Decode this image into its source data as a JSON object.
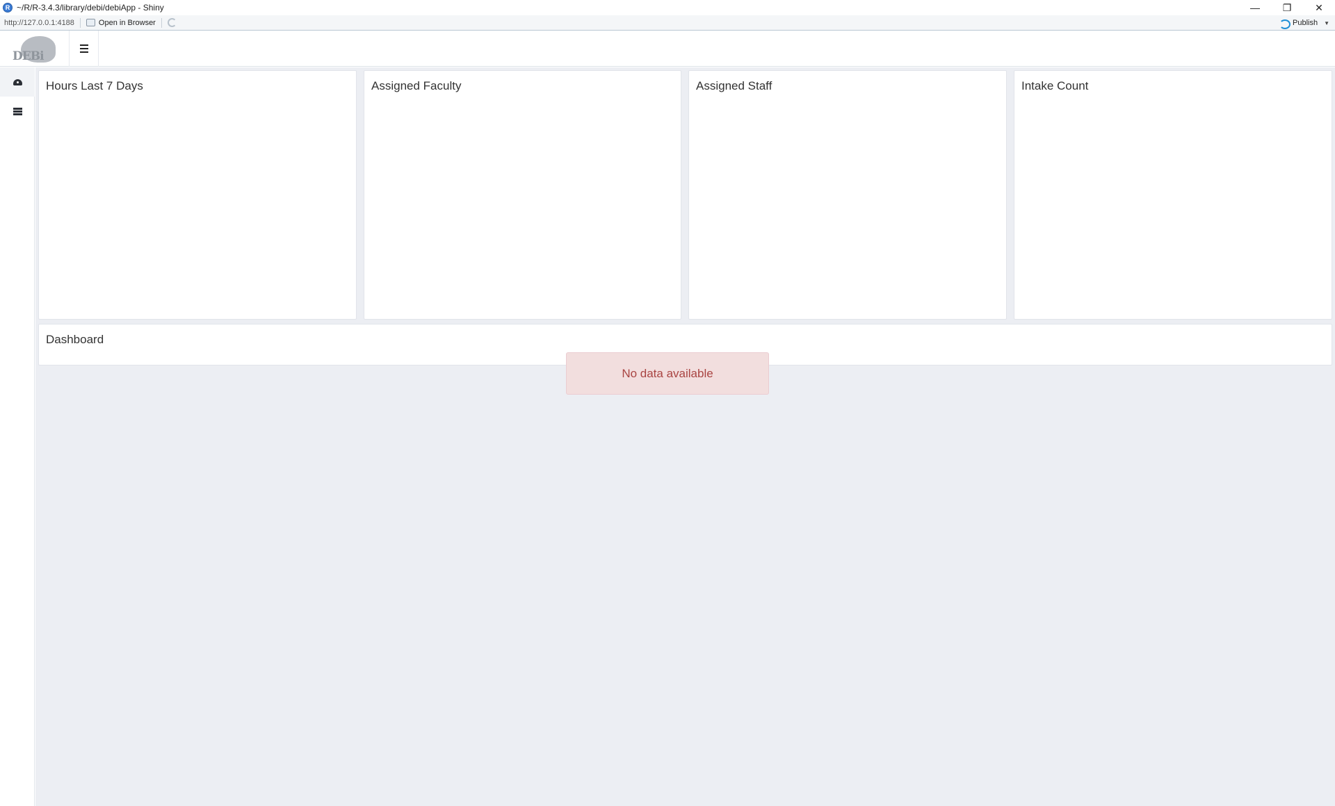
{
  "window": {
    "title": "~/R/R-3.4.3/library/debi/debiApp - Shiny",
    "app_icon": "R-studio-icon",
    "controls": [
      "minimize",
      "restore",
      "close"
    ]
  },
  "toolbar": {
    "url": "http://127.0.0.1:4188",
    "open_in_browser_label": "Open in Browser",
    "publish_label": "Publish"
  },
  "header": {
    "logo_text": "DEBi",
    "menu_icon": "hamburger-icon"
  },
  "sidebar": {
    "items": [
      {
        "icon": "dashboard-icon",
        "active": true
      },
      {
        "icon": "table-icon",
        "active": false
      }
    ]
  },
  "main": {
    "boxes": [
      {
        "title": "Hours Last 7 Days"
      },
      {
        "title": "Assigned Faculty"
      },
      {
        "title": "Assigned Staff"
      },
      {
        "title": "Intake Count"
      }
    ],
    "dashboard_title": "Dashboard",
    "alert_text": "No data available"
  },
  "colors": {
    "background": "#eceef3",
    "alert_bg": "#f2dede",
    "alert_text": "#a94442",
    "publish_accent": "#1f8fd6"
  }
}
